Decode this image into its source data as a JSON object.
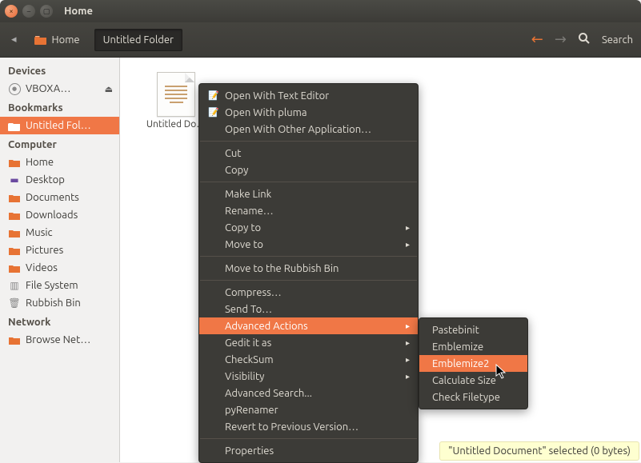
{
  "window": {
    "title": "Home"
  },
  "toolbar": {
    "crumb1": {
      "label": "Home"
    },
    "crumb2": {
      "label": "Untitled Folder"
    },
    "search_label": "Search"
  },
  "sidebar": {
    "devices_heading": "Devices",
    "devices": [
      {
        "label": "VBOXA…"
      }
    ],
    "bookmarks_heading": "Bookmarks",
    "bookmarks": [
      {
        "label": "Untitled Fol…"
      }
    ],
    "computer_heading": "Computer",
    "computer": [
      {
        "label": "Home"
      },
      {
        "label": "Desktop"
      },
      {
        "label": "Documents"
      },
      {
        "label": "Downloads"
      },
      {
        "label": "Music"
      },
      {
        "label": "Pictures"
      },
      {
        "label": "Videos"
      },
      {
        "label": "File System"
      },
      {
        "label": "Rubbish Bin"
      }
    ],
    "network_heading": "Network",
    "network": [
      {
        "label": "Browse Net…"
      }
    ]
  },
  "file": {
    "name": "Untitled Do…"
  },
  "context_menu": {
    "open_text": "Open With Text Editor",
    "open_pluma": "Open With pluma",
    "open_other": "Open With Other Application…",
    "cut": "Cut",
    "copy": "Copy",
    "make_link": "Make Link",
    "rename": "Rename…",
    "copy_to": "Copy to",
    "move_to": "Move to",
    "rubbish": "Move to the Rubbish Bin",
    "compress": "Compress…",
    "send_to": "Send To…",
    "advanced_actions": "Advanced Actions",
    "gedit": "Gedit it as",
    "checksum": "CheckSum",
    "visibility": "Visibility",
    "adv_search": "Advanced Search...",
    "pyrenamer": "pyRenamer",
    "revert": "Revert to Previous Version…",
    "properties": "Properties"
  },
  "submenu": {
    "pastebinit": "Pastebinit",
    "emblemize": "Emblemize",
    "emblemize2": "Emblemize2",
    "calc_size": "Calculate Size",
    "check_filetype": "Check Filetype"
  },
  "statusbar": {
    "text": "\"Untitled Document\" selected (0 bytes)"
  }
}
